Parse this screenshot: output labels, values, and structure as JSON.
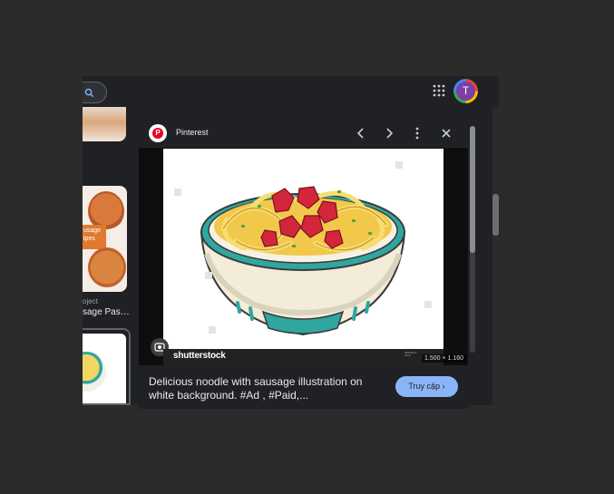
{
  "header": {
    "search_icon": "search-icon",
    "apps_icon": "apps-grid-icon",
    "avatar_initial": "T"
  },
  "sidebar": {
    "caption_small": "oject",
    "caption": "sage Pas…",
    "label_lines": [
      "usage",
      "ipes"
    ]
  },
  "preview": {
    "source": "Pinterest",
    "source_icon": "pinterest-icon",
    "prev_icon": "chevron-left-icon",
    "next_icon": "chevron-right-icon",
    "more_icon": "more-vert-icon",
    "close_icon": "close-icon",
    "watermark": "shutterstock",
    "image_dims": "1.500 × 1.160",
    "title": "Delicious noodle with sausage illustration on white background. #Ad , #Paid,...",
    "visit_label": "Truy cập",
    "visit_icon": "chevron-right-icon",
    "lens_icon": "lens-icon"
  },
  "colors": {
    "accent": "#8ab4f8",
    "pinterest": "#e60023",
    "bowl_teal": "#2fa7a0"
  }
}
